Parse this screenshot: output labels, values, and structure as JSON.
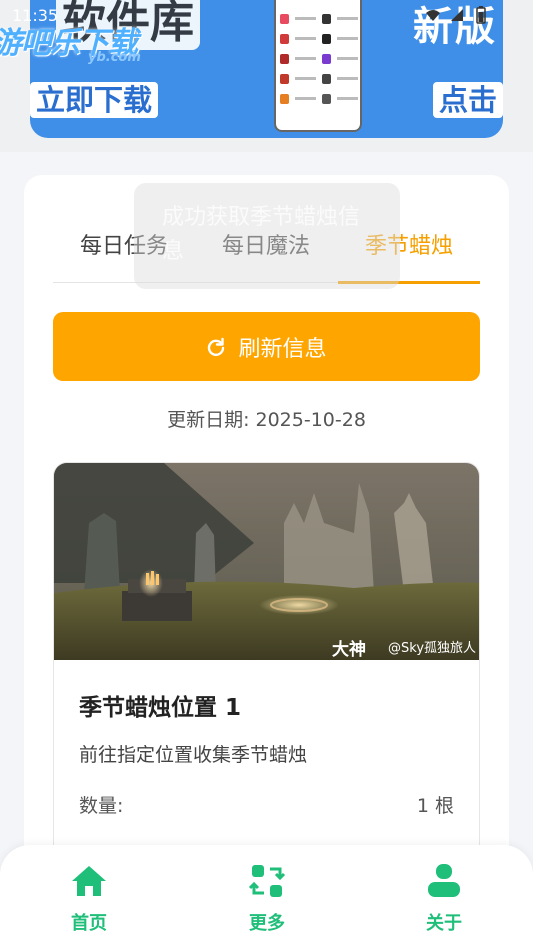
{
  "status_bar": {
    "time": "11:35"
  },
  "banner": {
    "headline_left": "软件库",
    "headline_right": "新版",
    "logo": "游吧乐下载",
    "logo_sub": "yb.com",
    "cta_left": "立即下载",
    "cta_right": "点击"
  },
  "tabs": [
    {
      "label": "每日任务",
      "active": false
    },
    {
      "label": "每日魔法",
      "active": false
    },
    {
      "label": "季节蜡烛",
      "active": true
    }
  ],
  "toast": {
    "message": "成功获取季节蜡烛信息"
  },
  "refresh": {
    "label": "刷新信息"
  },
  "update_date": "更新日期: 2025-10-28",
  "candle": {
    "title": "季节蜡烛位置 1",
    "description": "前往指定位置收集季节蜡烛",
    "quantity_label": "数量:",
    "quantity_value": "1 根",
    "watermark_brand": "大神",
    "watermark_author": "@Sky孤独旅人"
  },
  "nav": [
    {
      "label": "首页",
      "icon": "home-icon"
    },
    {
      "label": "更多",
      "icon": "swap-icon"
    },
    {
      "label": "关于",
      "icon": "user-icon"
    }
  ],
  "colors": {
    "accent": "#ffa500",
    "nav_green": "#1fbf7a",
    "banner_blue": "#3f8fe8"
  }
}
